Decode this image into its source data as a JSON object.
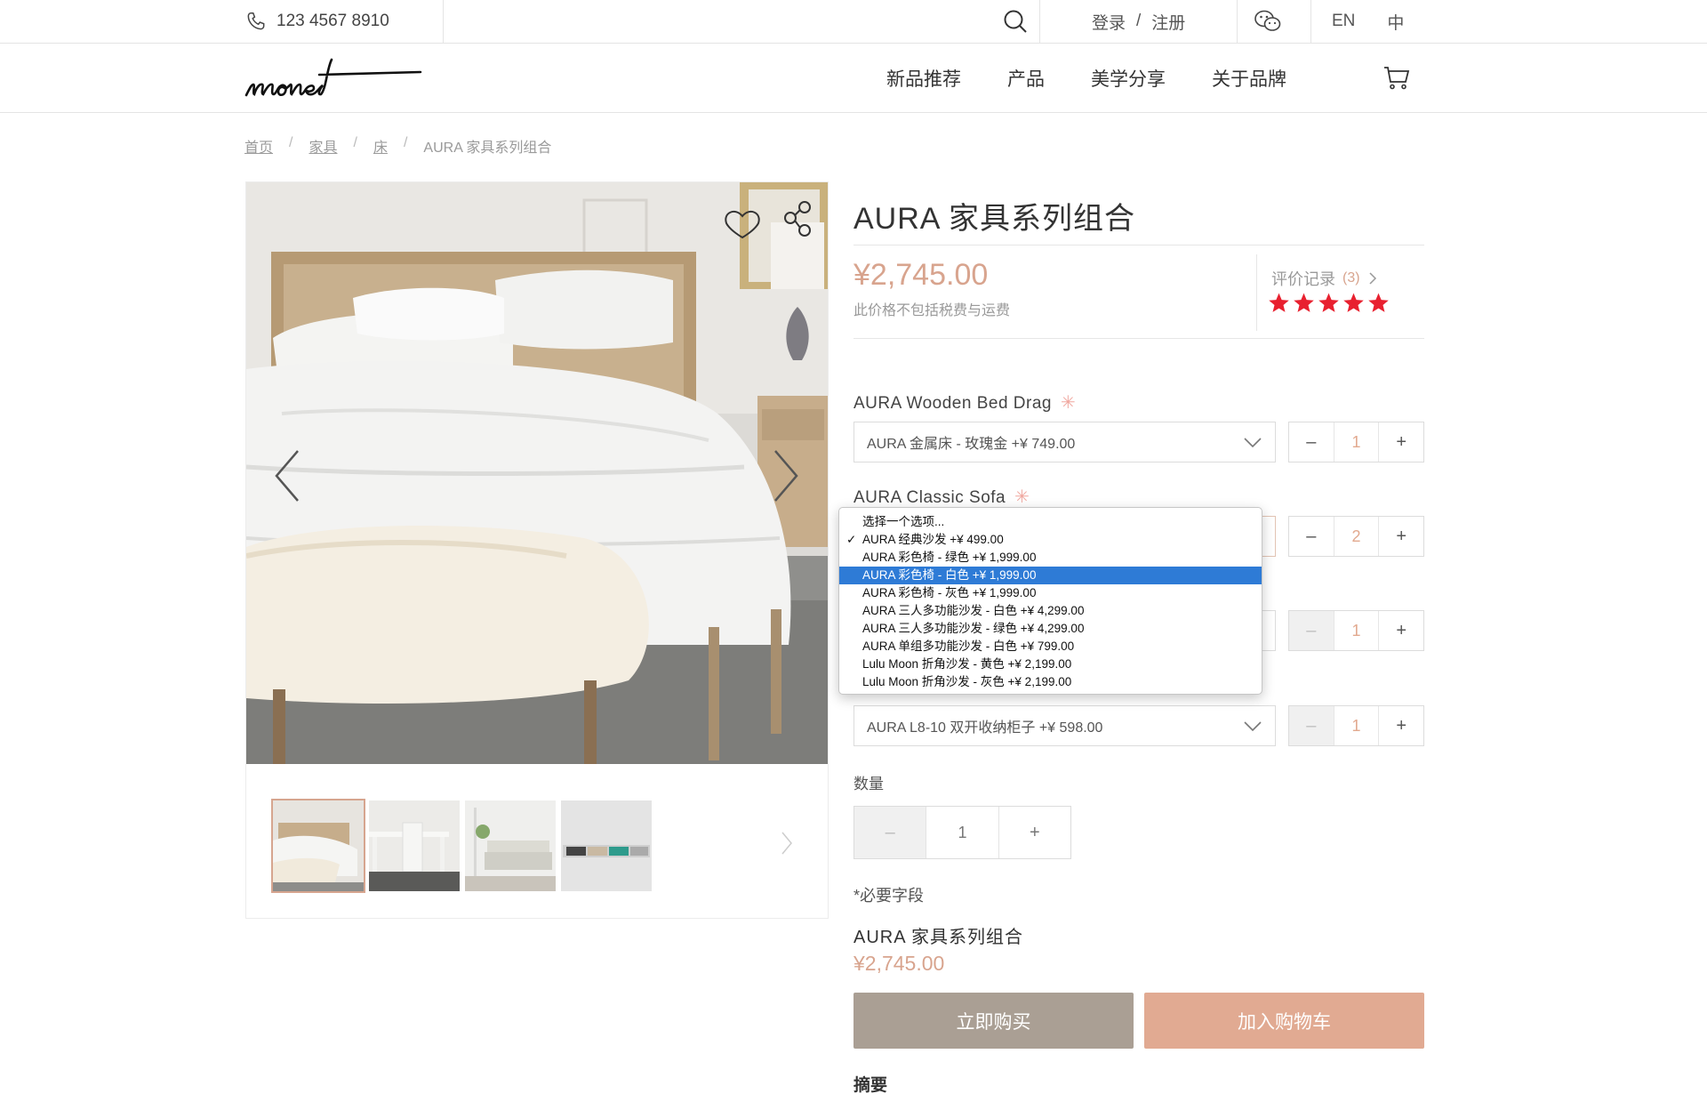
{
  "topbar": {
    "phone": "123  4567  8910",
    "login": "登录",
    "auth_sep": "/",
    "register": "注册",
    "lang_en": "EN",
    "lang_zh": "中"
  },
  "nav": {
    "logo": "monet",
    "links": [
      "新品推荐",
      "产品",
      "美学分享",
      "关于品牌"
    ]
  },
  "breadcrumb": {
    "items": [
      "首页",
      "家具",
      "床"
    ],
    "current": "AURA 家具系列组合",
    "sep": "/"
  },
  "product": {
    "title": "AURA  家具系列组合",
    "price": "¥2,745.00",
    "tax_note": "此价格不包括税费与运费",
    "reviews_label": "评价记录",
    "reviews_count": "(3)",
    "rating": 5,
    "rating_max": 5
  },
  "options": [
    {
      "label": "AURA  Wooden  Bed  Drag",
      "required": "✳",
      "selected": "AURA  金属床  -  玫瑰金  +¥  749.00",
      "qty": "1"
    },
    {
      "label": "AURA  Classic  Sofa",
      "required": "✳",
      "selected": "",
      "qty": "2"
    },
    {
      "label": "",
      "required": "",
      "selected": "",
      "qty": "1"
    },
    {
      "label": "",
      "required": "",
      "selected": "AURA  L8-10  双开收纳柜子  +¥  598.00",
      "qty": "1"
    }
  ],
  "dropdown": {
    "check": "✓",
    "items": [
      "选择一个选项...",
      "AURA 经典沙发 +¥ 499.00",
      "AURA 彩色椅 - 绿色 +¥ 1,999.00",
      "AURA 彩色椅 - 白色 +¥ 1,999.00",
      "AURA 彩色椅 - 灰色 +¥ 1,999.00",
      "AURA 三人多功能沙发 - 白色 +¥ 4,299.00",
      "AURA 三人多功能沙发 - 绿色 +¥ 4,299.00",
      "AURA 单组多功能沙发 - 白色 +¥ 799.00",
      "Lulu Moon 折角沙发 - 黄色 +¥ 2,199.00",
      "Lulu Moon 折角沙发 - 灰色 +¥ 2,199.00"
    ],
    "checked_index": 1,
    "highlighted_index": 3
  },
  "stepper": {
    "minus": "–",
    "plus": "+"
  },
  "quantity": {
    "label": "数量",
    "value": "1"
  },
  "summary": {
    "required_note": "*必要字段",
    "title": "AURA  家具系列组合",
    "price": "¥2,745.00"
  },
  "buttons": {
    "buy_now": "立即购买",
    "add_to_cart": "加入购物车"
  },
  "abstract_label": "摘要",
  "colors": {
    "accent": "#d8a48e",
    "buy_button": "#aa9f94",
    "cart_button": "#e1aa92",
    "star": "#e8202f",
    "highlight": "#2e7bd6"
  }
}
